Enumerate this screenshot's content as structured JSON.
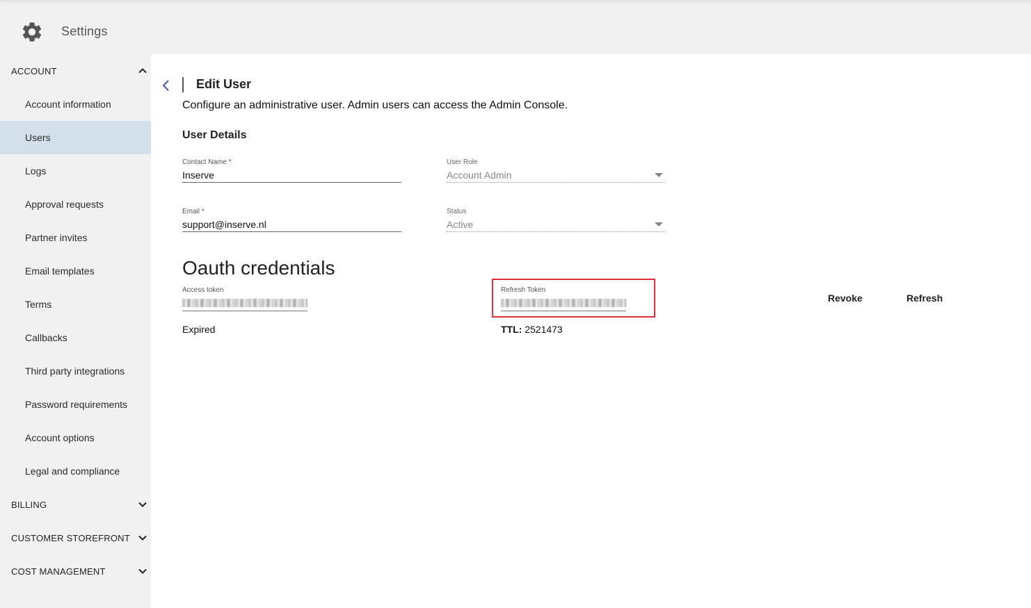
{
  "app": {
    "title": "Settings"
  },
  "sidebar": {
    "sections": {
      "account": "ACCOUNT",
      "billing": "BILLING",
      "storefront": "CUSTOMER STOREFRONT",
      "cost": "COST MANAGEMENT"
    },
    "items": [
      "Account information",
      "Users",
      "Logs",
      "Approval requests",
      "Partner invites",
      "Email templates",
      "Terms",
      "Callbacks",
      "Third party integrations",
      "Password requirements",
      "Account options",
      "Legal and compliance"
    ],
    "active_item": "Users"
  },
  "page": {
    "title": "Edit User",
    "description": "Configure an administrative user. Admin users can access the Admin Console.",
    "section_title": "User Details"
  },
  "form": {
    "contact_name": {
      "label": "Contact Name *",
      "value": "Inserve"
    },
    "user_role": {
      "label": "User Role",
      "value": "Account Admin"
    },
    "email": {
      "label": "Email *",
      "value": "support@inserve.nl"
    },
    "status": {
      "label": "Status",
      "value": "Active"
    }
  },
  "oauth": {
    "title": "Oauth credentials",
    "access_token_label": "Access token",
    "refresh_token_label": "Refresh Token",
    "access_status": "Expired",
    "ttl_label": "TTL:",
    "ttl_value": "2521473",
    "revoke_label": "Revoke",
    "refresh_label": "Refresh"
  },
  "colors": {
    "active_nav_bg": "#d3dfeb",
    "highlight_border": "#e0303c",
    "back_arrow": "#3b5ba9"
  },
  "icons": {
    "app": "gear-icon",
    "back": "chevron-left-icon",
    "expanded": "chevron-up-icon",
    "collapsed": "chevron-down-icon",
    "dropdown": "caret-down-icon"
  }
}
